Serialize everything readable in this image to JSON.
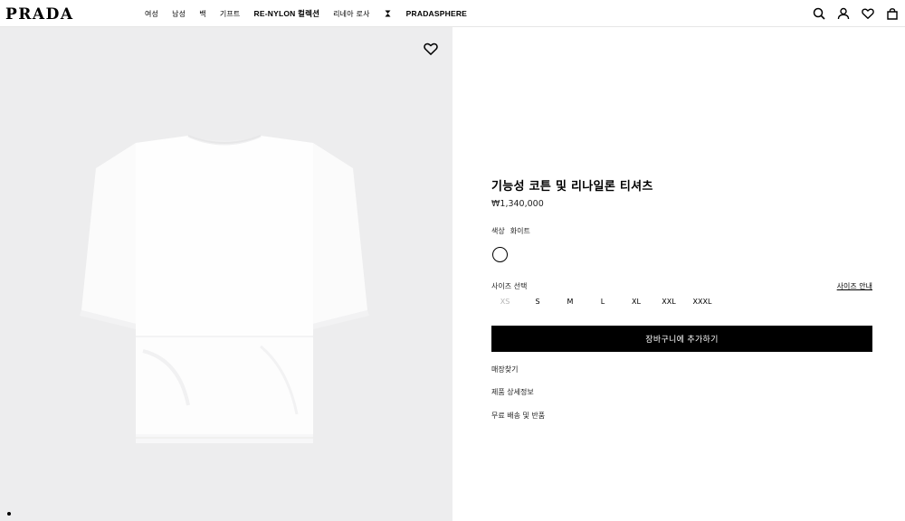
{
  "header": {
    "logo": "PRADA",
    "nav": [
      {
        "label": "여성",
        "bold": false
      },
      {
        "label": "남성",
        "bold": false
      },
      {
        "label": "백",
        "bold": false
      },
      {
        "label": "기프트",
        "bold": false
      },
      {
        "label": "RE-NYLON 컬렉션",
        "bold": true
      },
      {
        "label": "리네아 로사",
        "bold": false
      },
      {
        "label": "",
        "icon": "hourglass-icon"
      },
      {
        "label": "PRADASPHERE",
        "bold": true
      }
    ],
    "icons": [
      "search-icon",
      "account-icon",
      "wishlist-icon",
      "bag-icon"
    ]
  },
  "product": {
    "name": "기능성 코튼 및 리나일론 티셔츠",
    "price": "₩1,340,000",
    "color_label": "색상",
    "color_value": "화이트",
    "swatch_color": "#ffffff",
    "size_label": "사이즈 선택",
    "size_guide": "사이즈 안내",
    "sizes": [
      {
        "label": "XS",
        "available": false
      },
      {
        "label": "S",
        "available": true
      },
      {
        "label": "M",
        "available": true
      },
      {
        "label": "L",
        "available": true
      },
      {
        "label": "XL",
        "available": true
      },
      {
        "label": "XXL",
        "available": true
      },
      {
        "label": "XXXL",
        "available": true
      }
    ],
    "add_to_cart": "장바구니에 추가하기",
    "links": [
      "매장찾기",
      "제품 상세정보",
      "무료 배송 및 반품"
    ]
  },
  "colors": {
    "image_bg": "#ededee",
    "button_bg": "#000000",
    "disabled_size": "#b5b5b5"
  }
}
